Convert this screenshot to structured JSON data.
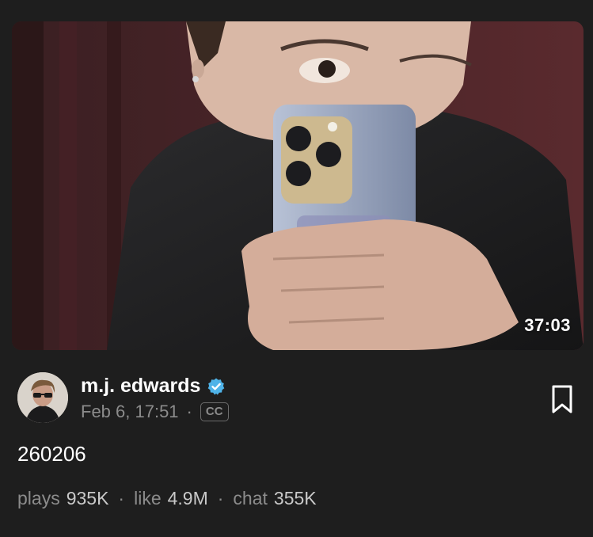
{
  "video": {
    "duration": "37:03"
  },
  "post": {
    "author": "m.j. edwards",
    "verified_icon": "verified-badge-icon",
    "date": "Feb 6, 17:51",
    "separator": "·",
    "cc_label": "CC",
    "caption": "260206"
  },
  "stats": {
    "plays_label": "plays",
    "plays_value": "935K",
    "like_label": "like",
    "like_value": "4.9M",
    "chat_label": "chat",
    "chat_value": "355K",
    "separator": "·"
  },
  "icons": {
    "bookmark": "bookmark-icon",
    "verified": "verified-badge-icon"
  },
  "colors": {
    "background": "#1e1e1e",
    "verified": "#4fb3e8",
    "muted_text": "#8c8c8c"
  }
}
